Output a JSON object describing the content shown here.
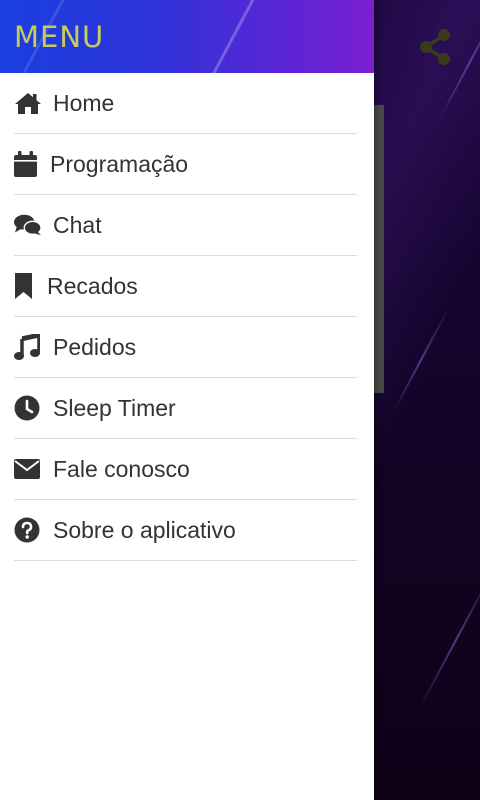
{
  "drawer": {
    "title": "MENU",
    "items": [
      {
        "label": "Home",
        "icon": "home-icon"
      },
      {
        "label": "Programação",
        "icon": "calendar-icon"
      },
      {
        "label": "Chat",
        "icon": "chat-icon"
      },
      {
        "label": "Recados",
        "icon": "bookmark-icon"
      },
      {
        "label": "Pedidos",
        "icon": "music-note-icon"
      },
      {
        "label": "Sleep Timer",
        "icon": "clock-icon"
      },
      {
        "label": "Fale conosco",
        "icon": "envelope-icon"
      },
      {
        "label": "Sobre o aplicativo",
        "icon": "question-circle-icon"
      }
    ]
  },
  "header": {
    "share_icon": "share-icon"
  },
  "colors": {
    "menu_title": "#c9cc5a",
    "icon": "#333333",
    "share_icon": "#3a3a1c",
    "header_start": "#1a3fe0",
    "header_end": "#7a1fd0"
  }
}
